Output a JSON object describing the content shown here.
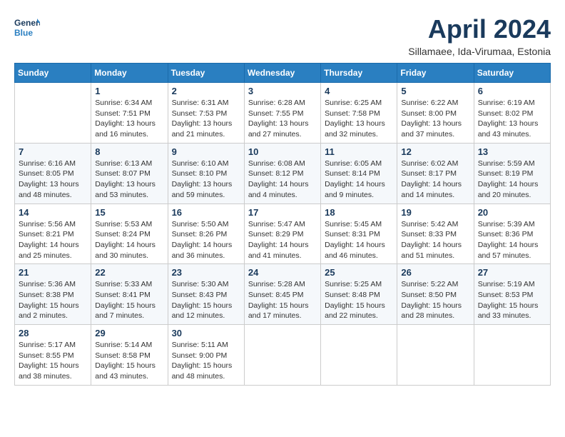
{
  "header": {
    "logo_line1": "General",
    "logo_line2": "Blue",
    "month_title": "April 2024",
    "location": "Sillamaee, Ida-Virumaa, Estonia"
  },
  "days_of_week": [
    "Sunday",
    "Monday",
    "Tuesday",
    "Wednesday",
    "Thursday",
    "Friday",
    "Saturday"
  ],
  "weeks": [
    [
      {
        "day": null
      },
      {
        "day": "1",
        "sunrise": "6:34 AM",
        "sunset": "7:51 PM",
        "daylight": "13 hours and 16 minutes."
      },
      {
        "day": "2",
        "sunrise": "6:31 AM",
        "sunset": "7:53 PM",
        "daylight": "13 hours and 21 minutes."
      },
      {
        "day": "3",
        "sunrise": "6:28 AM",
        "sunset": "7:55 PM",
        "daylight": "13 hours and 27 minutes."
      },
      {
        "day": "4",
        "sunrise": "6:25 AM",
        "sunset": "7:58 PM",
        "daylight": "13 hours and 32 minutes."
      },
      {
        "day": "5",
        "sunrise": "6:22 AM",
        "sunset": "8:00 PM",
        "daylight": "13 hours and 37 minutes."
      },
      {
        "day": "6",
        "sunrise": "6:19 AM",
        "sunset": "8:02 PM",
        "daylight": "13 hours and 43 minutes."
      }
    ],
    [
      {
        "day": "7",
        "sunrise": "6:16 AM",
        "sunset": "8:05 PM",
        "daylight": "13 hours and 48 minutes."
      },
      {
        "day": "8",
        "sunrise": "6:13 AM",
        "sunset": "8:07 PM",
        "daylight": "13 hours and 53 minutes."
      },
      {
        "day": "9",
        "sunrise": "6:10 AM",
        "sunset": "8:10 PM",
        "daylight": "13 hours and 59 minutes."
      },
      {
        "day": "10",
        "sunrise": "6:08 AM",
        "sunset": "8:12 PM",
        "daylight": "14 hours and 4 minutes."
      },
      {
        "day": "11",
        "sunrise": "6:05 AM",
        "sunset": "8:14 PM",
        "daylight": "14 hours and 9 minutes."
      },
      {
        "day": "12",
        "sunrise": "6:02 AM",
        "sunset": "8:17 PM",
        "daylight": "14 hours and 14 minutes."
      },
      {
        "day": "13",
        "sunrise": "5:59 AM",
        "sunset": "8:19 PM",
        "daylight": "14 hours and 20 minutes."
      }
    ],
    [
      {
        "day": "14",
        "sunrise": "5:56 AM",
        "sunset": "8:21 PM",
        "daylight": "14 hours and 25 minutes."
      },
      {
        "day": "15",
        "sunrise": "5:53 AM",
        "sunset": "8:24 PM",
        "daylight": "14 hours and 30 minutes."
      },
      {
        "day": "16",
        "sunrise": "5:50 AM",
        "sunset": "8:26 PM",
        "daylight": "14 hours and 36 minutes."
      },
      {
        "day": "17",
        "sunrise": "5:47 AM",
        "sunset": "8:29 PM",
        "daylight": "14 hours and 41 minutes."
      },
      {
        "day": "18",
        "sunrise": "5:45 AM",
        "sunset": "8:31 PM",
        "daylight": "14 hours and 46 minutes."
      },
      {
        "day": "19",
        "sunrise": "5:42 AM",
        "sunset": "8:33 PM",
        "daylight": "14 hours and 51 minutes."
      },
      {
        "day": "20",
        "sunrise": "5:39 AM",
        "sunset": "8:36 PM",
        "daylight": "14 hours and 57 minutes."
      }
    ],
    [
      {
        "day": "21",
        "sunrise": "5:36 AM",
        "sunset": "8:38 PM",
        "daylight": "15 hours and 2 minutes."
      },
      {
        "day": "22",
        "sunrise": "5:33 AM",
        "sunset": "8:41 PM",
        "daylight": "15 hours and 7 minutes."
      },
      {
        "day": "23",
        "sunrise": "5:30 AM",
        "sunset": "8:43 PM",
        "daylight": "15 hours and 12 minutes."
      },
      {
        "day": "24",
        "sunrise": "5:28 AM",
        "sunset": "8:45 PM",
        "daylight": "15 hours and 17 minutes."
      },
      {
        "day": "25",
        "sunrise": "5:25 AM",
        "sunset": "8:48 PM",
        "daylight": "15 hours and 22 minutes."
      },
      {
        "day": "26",
        "sunrise": "5:22 AM",
        "sunset": "8:50 PM",
        "daylight": "15 hours and 28 minutes."
      },
      {
        "day": "27",
        "sunrise": "5:19 AM",
        "sunset": "8:53 PM",
        "daylight": "15 hours and 33 minutes."
      }
    ],
    [
      {
        "day": "28",
        "sunrise": "5:17 AM",
        "sunset": "8:55 PM",
        "daylight": "15 hours and 38 minutes."
      },
      {
        "day": "29",
        "sunrise": "5:14 AM",
        "sunset": "8:58 PM",
        "daylight": "15 hours and 43 minutes."
      },
      {
        "day": "30",
        "sunrise": "5:11 AM",
        "sunset": "9:00 PM",
        "daylight": "15 hours and 48 minutes."
      },
      {
        "day": null
      },
      {
        "day": null
      },
      {
        "day": null
      },
      {
        "day": null
      }
    ]
  ]
}
